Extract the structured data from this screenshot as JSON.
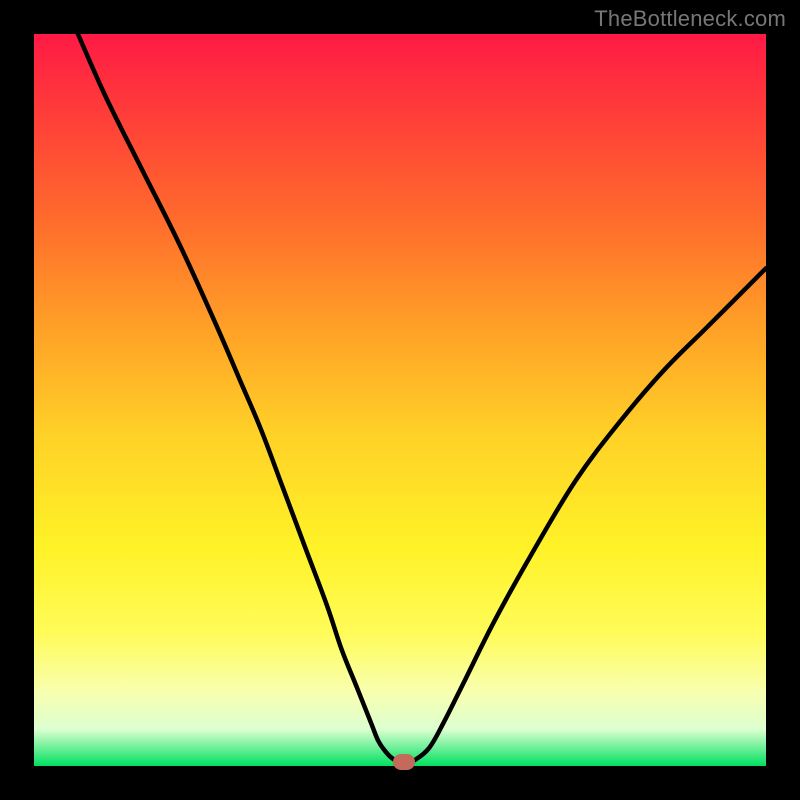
{
  "watermark": "TheBottleneck.com",
  "colors": {
    "background": "#000000",
    "curve_stroke": "#000000",
    "marker_fill": "#c36a5a"
  },
  "chart_data": {
    "type": "line",
    "title": "",
    "xlabel": "",
    "ylabel": "",
    "xlim": [
      0,
      100
    ],
    "ylim": [
      0,
      100
    ],
    "series": [
      {
        "name": "bottleneck-curve",
        "x": [
          6,
          10,
          15,
          20,
          25,
          28,
          31,
          34,
          37,
          40,
          42,
          44,
          46,
          47,
          48,
          49,
          50,
          51,
          52,
          54,
          56,
          59,
          63,
          68,
          74,
          80,
          86,
          92,
          100
        ],
        "y": [
          100,
          91,
          81,
          71,
          60,
          53,
          46,
          38,
          30,
          22,
          16,
          11,
          6,
          3.5,
          2,
          1,
          0.5,
          0.5,
          0.8,
          2.5,
          6,
          12,
          20,
          29,
          39,
          47,
          54,
          60,
          68
        ]
      }
    ],
    "marker": {
      "x": 50.5,
      "y": 0.5
    },
    "gradient_stops": [
      {
        "pos": 0,
        "color": "#ff1a45"
      },
      {
        "pos": 10,
        "color": "#ff3a3a"
      },
      {
        "pos": 25,
        "color": "#ff6a2c"
      },
      {
        "pos": 40,
        "color": "#ffa027"
      },
      {
        "pos": 55,
        "color": "#ffd227"
      },
      {
        "pos": 70,
        "color": "#fff227"
      },
      {
        "pos": 82,
        "color": "#fffc5a"
      },
      {
        "pos": 90,
        "color": "#f8ffb0"
      },
      {
        "pos": 95,
        "color": "#dcffd0"
      },
      {
        "pos": 100,
        "color": "#00e060"
      }
    ]
  }
}
